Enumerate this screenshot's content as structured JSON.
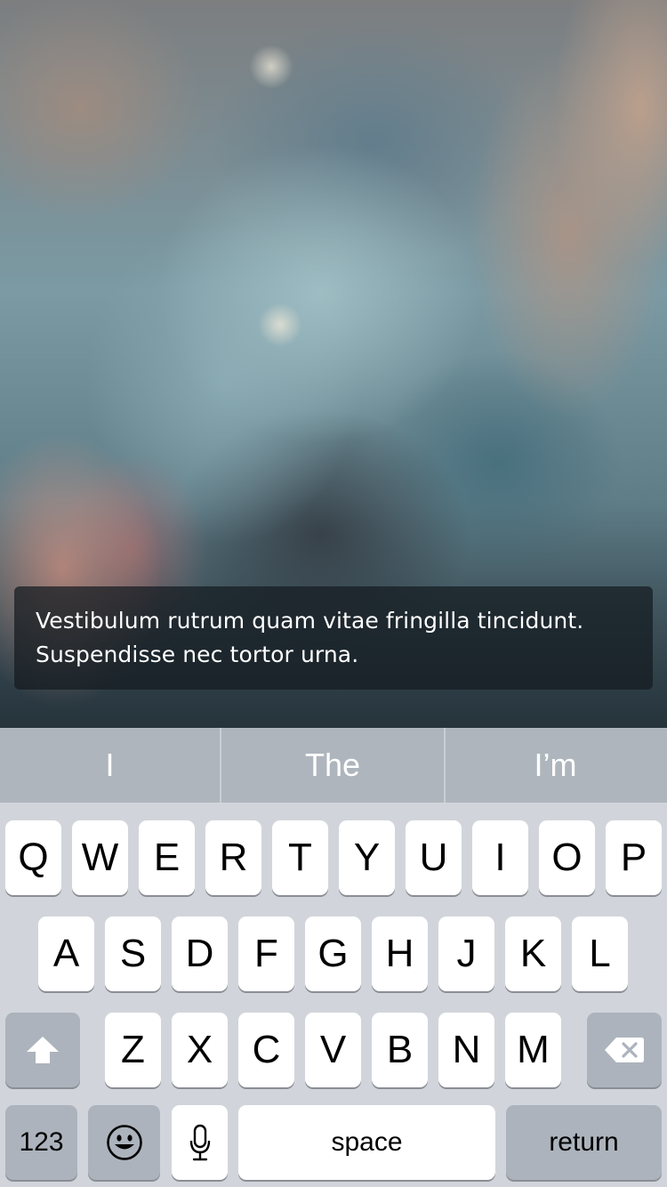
{
  "message": {
    "line1": "Vestibulum rutrum quam vitae fringilla tincidunt.",
    "line2": "Suspendisse nec tortor urna."
  },
  "predictive": [
    "I",
    "The",
    "I’m"
  ],
  "keyboard": {
    "row1": [
      "Q",
      "W",
      "E",
      "R",
      "T",
      "Y",
      "U",
      "I",
      "O",
      "P"
    ],
    "row2": [
      "A",
      "S",
      "D",
      "F",
      "G",
      "H",
      "J",
      "K",
      "L"
    ],
    "row3": [
      "Z",
      "X",
      "C",
      "V",
      "B",
      "N",
      "M"
    ],
    "numbers_label": "123",
    "space_label": "space",
    "return_label": "return",
    "icons": {
      "shift": "shift-icon",
      "delete": "delete-icon",
      "emoji": "emoji-icon",
      "mic": "microphone-icon"
    }
  },
  "colors": {
    "keyboard_bg": "#d1d5db",
    "function_key": "#acb3bc",
    "predictive_bar": "#aeb5bd"
  }
}
